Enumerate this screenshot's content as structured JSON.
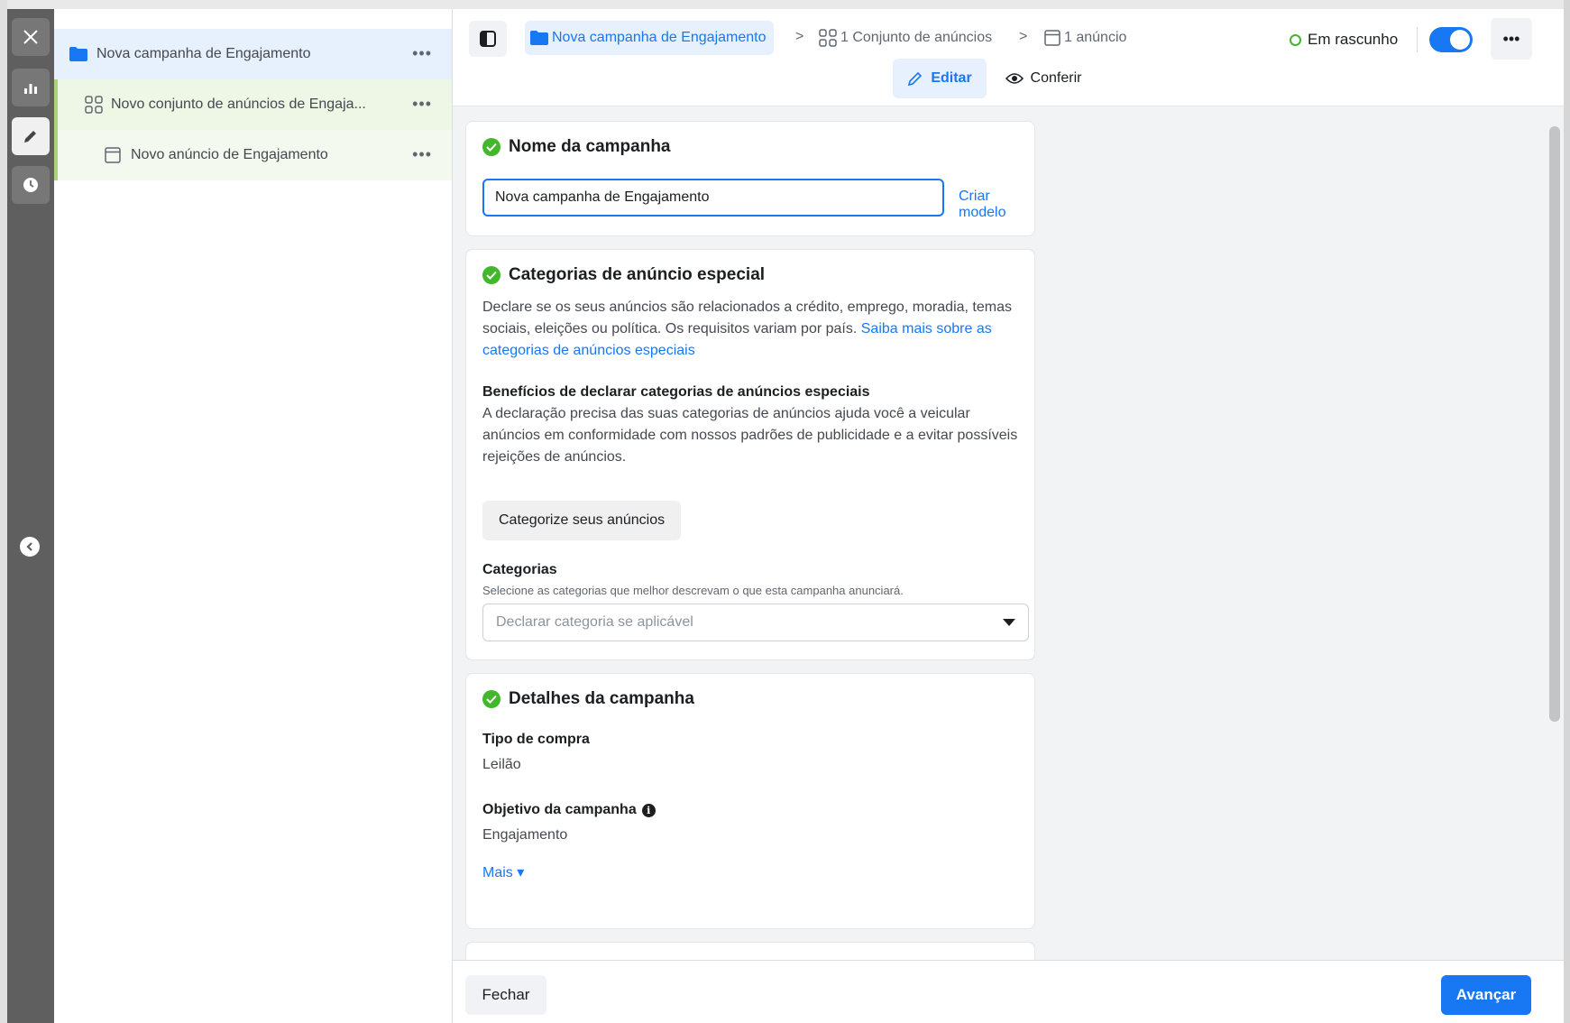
{
  "sidebar_tree": {
    "campaign": {
      "label": "Nova campanha de Engajamento",
      "more": "•••"
    },
    "ad_set": {
      "label": "Novo conjunto de anúncios de Engaja...",
      "more": "•••"
    },
    "ad": {
      "label": "Novo anúncio de Engajamento",
      "more": "•••"
    }
  },
  "rail": {
    "icons": [
      "close-icon",
      "chart-icon",
      "pencil-icon",
      "clock-icon",
      "chevron-left-icon"
    ]
  },
  "header": {
    "breadcrumb": {
      "campaign": "Nova campanha de Engajamento",
      "ad_sets": "1 Conjunto de anúncios",
      "ads": "1 anúncio",
      "separator": ">"
    },
    "status": "Em rascunho",
    "more": "•••",
    "tabs": {
      "edit": "Editar",
      "review": "Conferir"
    }
  },
  "campaign_name_card": {
    "title": "Nome da campanha",
    "input_value": "Nova campanha de Engajamento",
    "create_template": "Criar modelo"
  },
  "special_categories_card": {
    "title": "Categorias de anúncio especial",
    "description": "Declare se os seus anúncios são relacionados a crédito, emprego, moradia, temas sociais, eleições ou política. Os requisitos variam por país.",
    "learn_more": "Saiba mais sobre as categorias de anúncios especiais",
    "benefits_title": "Benefícios de declarar categorias de anúncios especiais",
    "benefits_text": "A declaração precisa das suas categorias de anúncios ajuda você a veicular anúncios em conformidade com nossos padrões de publicidade e a evitar possíveis rejeições de anúncios.",
    "categorize_button": "Categorize seus anúncios",
    "categories_label": "Categorias",
    "categories_help": "Selecione as categorias que melhor descrevam o que esta campanha anunciará.",
    "categories_placeholder": "Declarar categoria se aplicável"
  },
  "details_card": {
    "title": "Detalhes da campanha",
    "buy_type_label": "Tipo de compra",
    "buy_type_value": "Leilão",
    "objective_label": "Objetivo da campanha",
    "objective_value": "Engajamento",
    "more_link": "Mais ▾"
  },
  "footer": {
    "close": "Fechar",
    "next": "Avançar"
  },
  "colors": {
    "accent": "#1877f2",
    "success": "#42b72a",
    "rail": "#5f5f5f"
  }
}
